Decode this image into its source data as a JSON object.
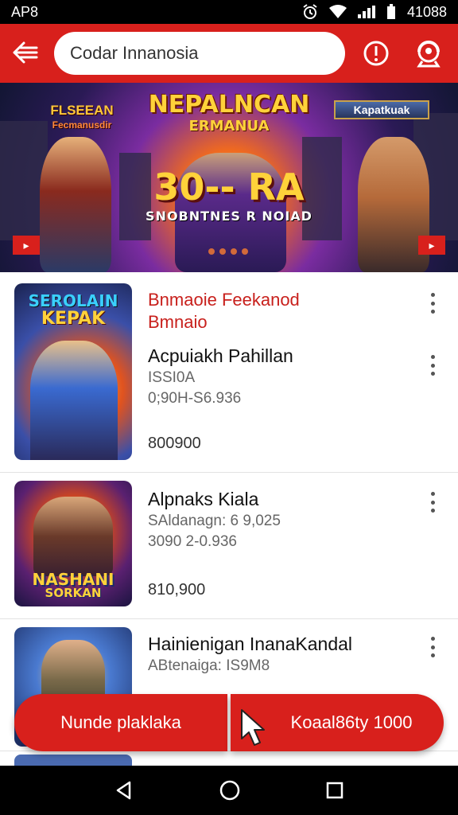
{
  "status_bar": {
    "left_text": "AP8",
    "time": "41088"
  },
  "header": {
    "search_text": "Codar Innanosia"
  },
  "banner": {
    "title": "NEPALNCAN",
    "subtitle": "ERMANUA",
    "left_logo_line1": "FLSEEAN",
    "left_logo_line2": "Fecmanusdir",
    "right_logo": "Kapatkuak",
    "big_text": "30-- RA",
    "tagline": "SNOBNTNES R NOIAD"
  },
  "items": [
    {
      "thumb_text_top": "SEROLAIN",
      "thumb_text_bottom": "KEPAK",
      "promo_line1": "Bnmaoie Feekanod",
      "promo_line2": "Bmnaio",
      "name": "Acpuiakh Pahillan",
      "meta1": "ISSI0A",
      "meta2": "0;90H-S6.936",
      "price": "800900"
    },
    {
      "thumb_text_top": "NASHANI",
      "thumb_text_bottom": "SORKAN",
      "name": "Alpnaks Kiala",
      "meta1": "SAldanagn: 6 9,025",
      "meta2": "3090 2-0.936",
      "price": "810,900"
    },
    {
      "name": "Hainienigan InanaKandal",
      "meta1": "ABtenaiga: IS9M8"
    }
  ],
  "actions": {
    "left_label": "Nunde plaklaka",
    "right_label": "Koaal86ty 1000"
  },
  "colors": {
    "brand_red": "#d8201c",
    "promo_red": "#c8201c"
  }
}
